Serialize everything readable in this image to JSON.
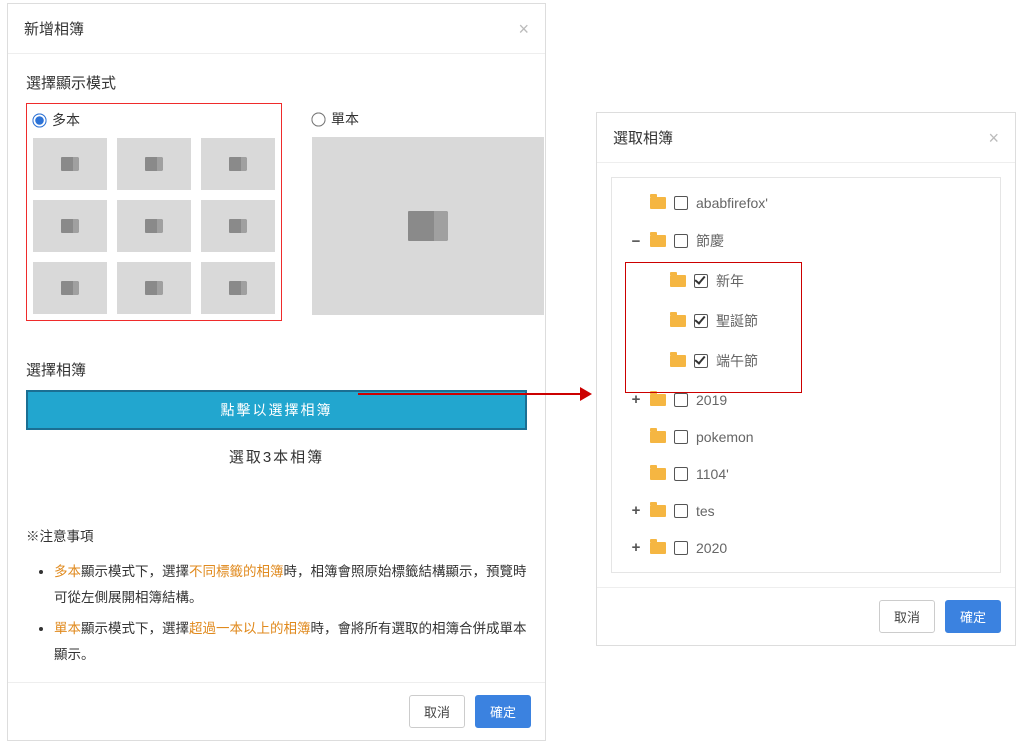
{
  "left_modal": {
    "title": "新增相簿",
    "section_mode": "選擇顯示模式",
    "mode_multi": "多本",
    "mode_single": "單本",
    "section_select": "選擇相簿",
    "select_btn": "點擊以選擇相簿",
    "selected_count": "選取3本相簿",
    "notes_title": "※注意事項",
    "note1_a": "多本",
    "note1_b": "顯示模式下，選擇",
    "note1_c": "不同標籤的相簿",
    "note1_d": "時，相簿會照原始標籤結構顯示，預覽時可從左側展開相簿結構。",
    "note2_a": "單本",
    "note2_b": "顯示模式下，選擇",
    "note2_c": "超過一本以上的相簿",
    "note2_d": "時，會將所有選取的相簿合併成單本顯示。",
    "cancel": "取消",
    "confirm": "確定"
  },
  "right_modal": {
    "title": "選取相簿",
    "items": [
      {
        "label": "ababfirefox'"
      },
      {
        "label": "節慶"
      },
      {
        "label": "新年"
      },
      {
        "label": "聖誕節"
      },
      {
        "label": "端午節"
      },
      {
        "label": "2019"
      },
      {
        "label": "pokemon"
      },
      {
        "label": "1104'"
      },
      {
        "label": "tes"
      },
      {
        "label": "2020"
      }
    ],
    "cancel": "取消",
    "confirm": "確定"
  }
}
